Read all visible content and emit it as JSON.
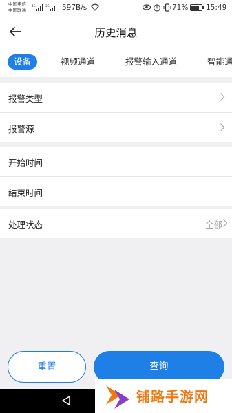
{
  "status_bar": {
    "carrier_1": "中国电信",
    "carrier_2": "中国联通",
    "net_speed": "597B/s",
    "battery": "71%",
    "time": "15:49"
  },
  "header": {
    "title": "历史消息"
  },
  "tabs": [
    {
      "label": "设备",
      "active": true
    },
    {
      "label": "视频通道",
      "active": false
    },
    {
      "label": "报警输入通道",
      "active": false
    },
    {
      "label": "智能通",
      "active": false
    }
  ],
  "filters": {
    "alarm_type": {
      "label": "报警类型"
    },
    "alarm_source": {
      "label": "报警源"
    },
    "start_time": {
      "label": "开始时间"
    },
    "end_time": {
      "label": "结束时间"
    },
    "process_status": {
      "label": "处理状态",
      "value": "全部"
    }
  },
  "buttons": {
    "reset": "重置",
    "query": "查询"
  },
  "watermark": {
    "text": "铺路手游网"
  },
  "colors": {
    "accent": "#1e7fe6",
    "background": "#f0f0f2",
    "watermark": "#f07a12"
  }
}
